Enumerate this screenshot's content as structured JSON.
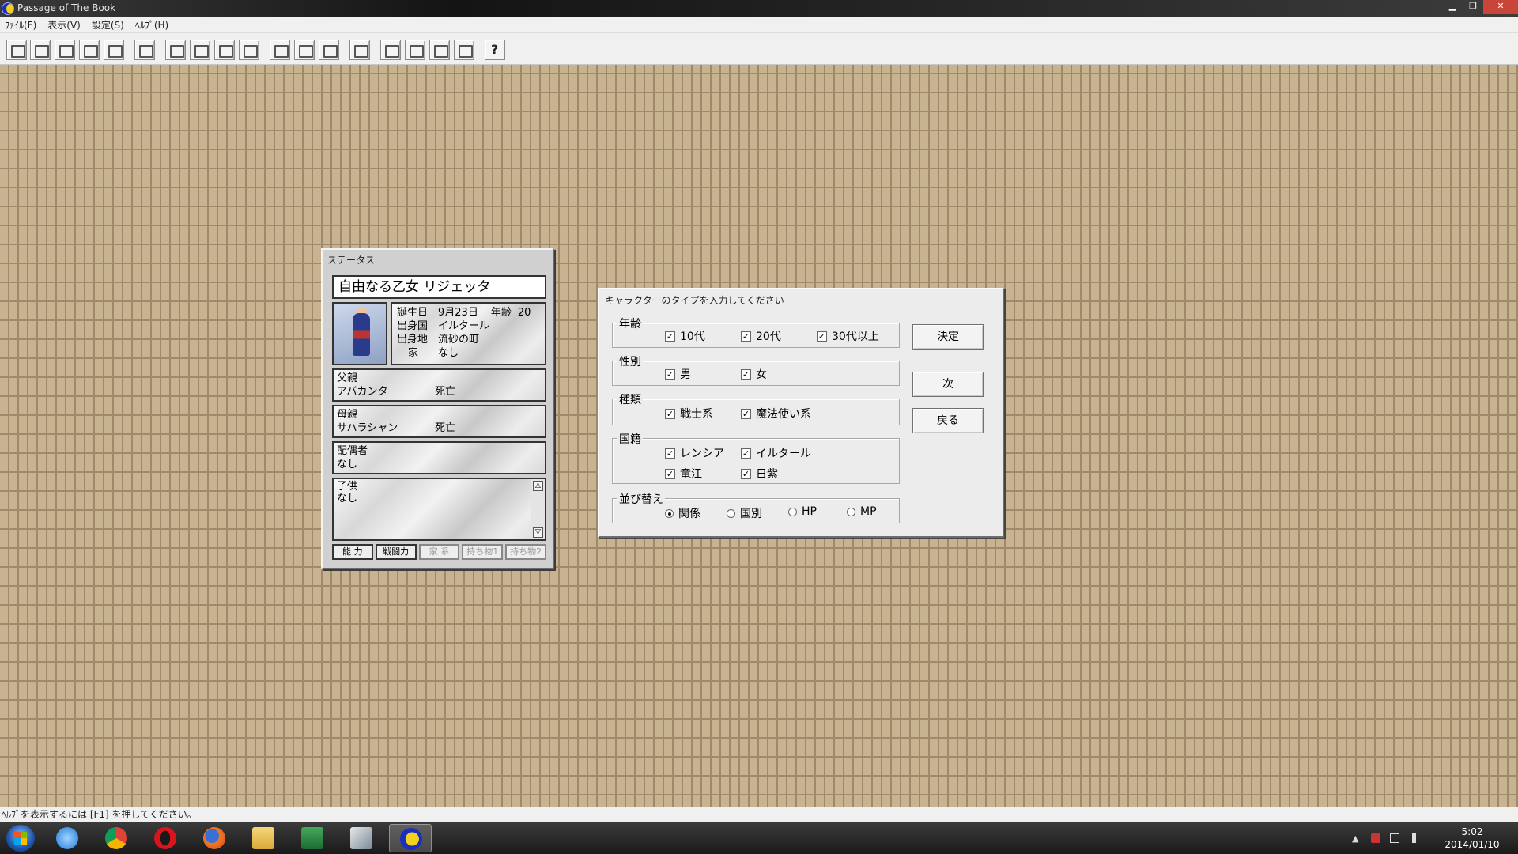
{
  "window": {
    "title": "Passage of The Book",
    "min": "▁",
    "max": "❐",
    "close": "✕"
  },
  "menu": [
    "ﾌｧｲﾙ(F)",
    "表示(V)",
    "設定(S)",
    "ﾍﾙﾌﾟ(H)"
  ],
  "toolbar": {
    "icons": [
      "window-icon",
      "panel-icon",
      "map-icon",
      "list-icon",
      "list-detail-icon",
      "grid-icon",
      "door-icon",
      "star-icon",
      "pot-icon",
      "board-icon",
      "scroll-icon",
      "book-icon",
      "person-icon",
      "hand-icon",
      "dice-icon",
      "arrow-icon",
      "pages-icon",
      "triangle-icon",
      "help-icon"
    ]
  },
  "status": {
    "title": "ステータス",
    "name": "自由なる乙女 リジェッタ",
    "birthday_label": "誕生日",
    "birthday": "9月23日",
    "age_label": "年齢",
    "age": "20",
    "country_label": "出身国",
    "country": "イルタール",
    "hometown_label": "出身地",
    "hometown": "流砂の町",
    "house_label": "家",
    "house": "なし",
    "father_label": "父親",
    "father_name": "アバカンタ",
    "father_status": "死亡",
    "mother_label": "母親",
    "mother_name": "サハラシャン",
    "mother_status": "死亡",
    "spouse_label": "配偶者",
    "spouse": "なし",
    "children_label": "子供",
    "children": "なし",
    "scroll_up": "△",
    "scroll_down": "▽",
    "tabs": [
      "能 力",
      "戦闘力",
      "家 系",
      "持ち物1",
      "持ち物2"
    ]
  },
  "dialog": {
    "title": "キャラクターのタイプを入力してください",
    "age": {
      "label": "年齢",
      "options": [
        "10代",
        "20代",
        "30代以上"
      ]
    },
    "gender": {
      "label": "性別",
      "options": [
        "男",
        "女"
      ]
    },
    "kind": {
      "label": "種類",
      "options": [
        "戦士系",
        "魔法使い系"
      ]
    },
    "nation": {
      "label": "国籍",
      "options": [
        "レンシア",
        "イルタール",
        "竜江",
        "日紫"
      ]
    },
    "sort": {
      "label": "並び替え",
      "options": [
        "関係",
        "国別",
        "HP",
        "MP"
      ],
      "selected": "関係"
    },
    "check": "✓",
    "buttons": {
      "ok": "決定",
      "next": "次",
      "back": "戻る"
    }
  },
  "statusbar": {
    "text": "ﾍﾙﾌﾟを表示するには [F1] を押してください。"
  },
  "taskbar": {
    "apps": [
      "internet-explorer-icon",
      "chrome-icon",
      "opera-icon",
      "firefox-icon",
      "explorer-folder-icon",
      "excel-icon",
      "app-icon",
      "passage-icon"
    ],
    "time": "5:02",
    "date": "2014/01/10",
    "tray_arrow": "▲"
  }
}
